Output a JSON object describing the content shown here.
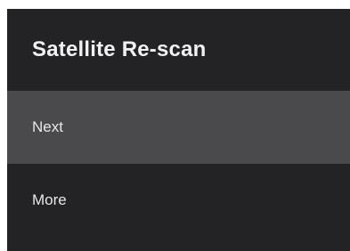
{
  "header": {
    "title": "Satellite Re-scan"
  },
  "menu": {
    "items": [
      {
        "label": "Next",
        "selected": true
      },
      {
        "label": "More",
        "selected": false
      }
    ]
  },
  "colors": {
    "background": "#232326",
    "selected_row": "#4a4a4d",
    "text": "#f1f1f3"
  }
}
